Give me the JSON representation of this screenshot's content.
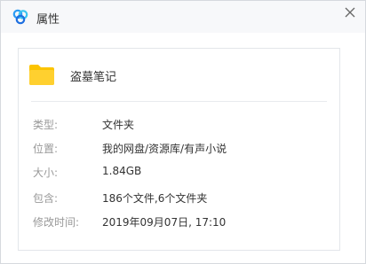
{
  "window": {
    "title": "属性",
    "app_icon": "baidu-netdisk-cloud-icon",
    "close_icon": "close-icon"
  },
  "file": {
    "icon": "folder-icon",
    "icon_color": "#fcc400",
    "name": "盗墓笔记"
  },
  "properties": [
    {
      "label": "类型:",
      "value": "文件夹"
    },
    {
      "label": "位置:",
      "value": "我的网盘/资源库/有声小说"
    },
    {
      "label": "大小:",
      "value": "1.84GB"
    },
    {
      "label": "包含:",
      "value": "186个文件,6个文件夹"
    },
    {
      "label": "修改时间:",
      "value": "2019年09月07日, 17:10"
    }
  ]
}
